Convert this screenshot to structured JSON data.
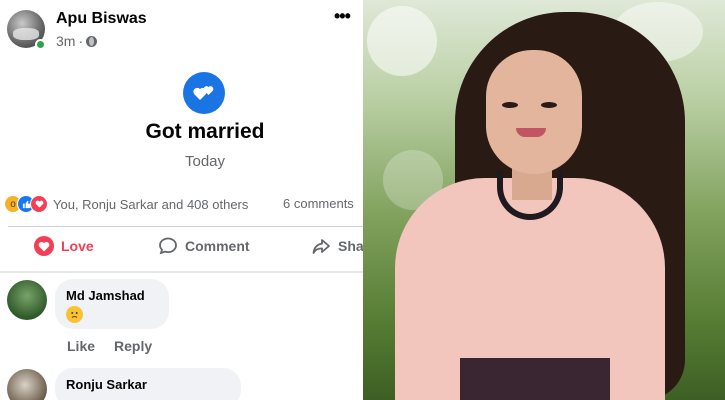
{
  "post": {
    "author": "Apu Biswas",
    "time": "3m",
    "separator": "·",
    "event_title": "Got married",
    "event_date": "Today",
    "reactions_text": "You, Ronju Sarkar and 408 others",
    "comments_text": "6 comments",
    "actions": {
      "love": "Love",
      "comment": "Comment",
      "share": "Share"
    }
  },
  "comments": [
    {
      "name": "Md Jamshad",
      "emoji": "sad-face"
    },
    {
      "name": "Ronju Sarkar"
    }
  ],
  "comment_actions": {
    "like": "Like",
    "reply": "Reply"
  },
  "colors": {
    "facebook_blue": "#1b74e4",
    "love_red": "#f33e58",
    "secondary_text": "#65676b",
    "bubble_gray": "#f0f2f5"
  },
  "icons": [
    "globe-icon",
    "more-icon",
    "heart-event-icon",
    "wow-reaction-icon",
    "like-reaction-icon",
    "love-reaction-icon",
    "love-icon",
    "comment-icon",
    "share-icon"
  ]
}
